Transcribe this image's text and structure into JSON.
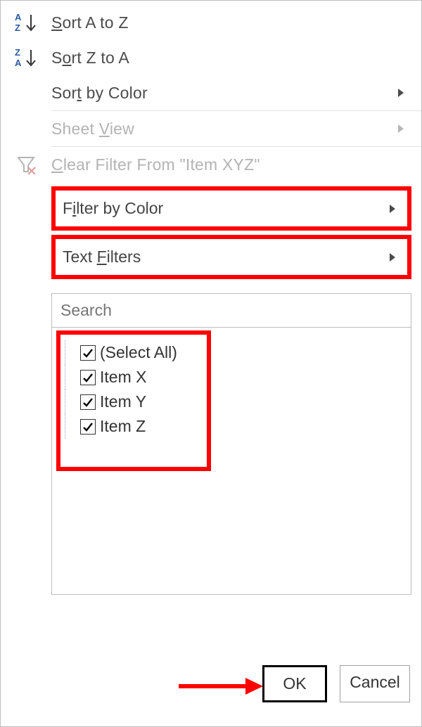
{
  "sort_asc": "Sort A to Z",
  "sort_desc": "Sort Z to A",
  "sort_color": "Sort by Color",
  "sheet_view": "Sheet View",
  "clear_filter": "Clear Filter From \"Item XYZ\"",
  "filter_color": "Filter by Color",
  "text_filters": "Text Filters",
  "search_placeholder": "Search",
  "checklist": {
    "select_all": "(Select All)",
    "items": [
      "Item X",
      "Item Y",
      "Item Z"
    ]
  },
  "ok": "OK",
  "cancel": "Cancel"
}
